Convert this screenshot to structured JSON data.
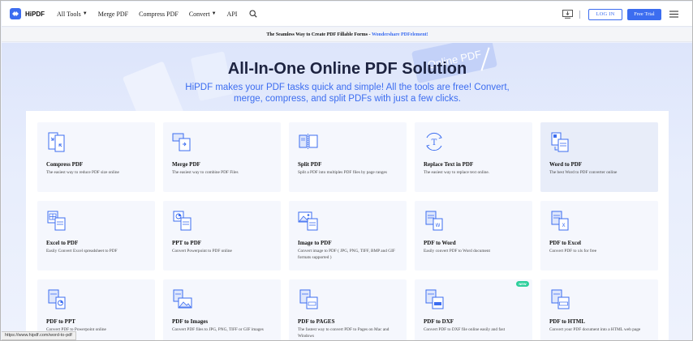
{
  "header": {
    "logo_text": "HiPDF",
    "nav": [
      {
        "label": "All Tools",
        "has_caret": true
      },
      {
        "label": "Merge PDF",
        "has_caret": false
      },
      {
        "label": "Compress PDF",
        "has_caret": false
      },
      {
        "label": "Convert",
        "has_caret": true
      },
      {
        "label": "API",
        "has_caret": false
      }
    ],
    "login_label": "LOG IN",
    "trial_label": "Free Trial"
  },
  "banner": {
    "text": "The Seamless Way to Create PDF Fillable Forms - ",
    "link": "Wondershare PDFelement!"
  },
  "hero": {
    "stamp_text": "Online PDF",
    "title": "All-In-One Online PDF Solution",
    "subtitle": "HiPDF makes your PDF tasks quick and simple! All the tools are free! Convert, merge, compress, and split PDFs with just a few clicks."
  },
  "tools": [
    {
      "title": "Compress PDF",
      "desc": "The easiest way to reduce PDF size online",
      "icon": "compress-icon"
    },
    {
      "title": "Merge PDF",
      "desc": "The easiest way to combine PDF Files",
      "icon": "merge-icon"
    },
    {
      "title": "Split PDF",
      "desc": "Split a PDF into multiples PDF files by page ranges",
      "icon": "split-icon"
    },
    {
      "title": "Replace Text in PDF",
      "desc": "The easiest way to replace text online.",
      "icon": "replace-text-icon"
    },
    {
      "title": "Word to PDF",
      "desc": "The best Word to PDF converter online",
      "icon": "word-to-pdf-icon"
    },
    {
      "title": "Excel to PDF",
      "desc": "Easily Convert Excel spreadsheet to PDF",
      "icon": "excel-to-pdf-icon"
    },
    {
      "title": "PPT to PDF",
      "desc": "Convert Powerpoint to PDF online",
      "icon": "ppt-to-pdf-icon"
    },
    {
      "title": "Image to PDF",
      "desc": "Convert image to PDF ( JPG, PNG, TIFF, BMP and GIF formats supported )",
      "icon": "image-to-pdf-icon"
    },
    {
      "title": "PDF to Word",
      "desc": "Easily convert PDF to Word document",
      "icon": "pdf-to-word-icon"
    },
    {
      "title": "PDF to Excel",
      "desc": "Convert PDF to xls for free",
      "icon": "pdf-to-excel-icon"
    },
    {
      "title": "PDF to PPT",
      "desc": "Convert PDF to Powerpoint online",
      "icon": "pdf-to-ppt-icon"
    },
    {
      "title": "PDF to Images",
      "desc": "Convert PDF files to JPG, PNG, TIFF or GIF images",
      "icon": "pdf-to-images-icon"
    },
    {
      "title": "PDF to PAGES",
      "desc": "The fastest way to convert PDF to Pages on Mac and Windows",
      "icon": "pdf-to-pages-icon"
    },
    {
      "title": "PDF to DXF",
      "desc": "Convert PDF to DXF file online easily and fast",
      "icon": "pdf-to-dxf-icon",
      "badge": "NEW"
    },
    {
      "title": "PDF to HTML",
      "desc": "Convert your PDF document into a HTML web page",
      "icon": "pdf-to-html-icon"
    }
  ],
  "status_url": "https://www.hipdf.com/word-to-pdf",
  "colors": {
    "accent": "#3c6df0",
    "badge": "#2ecf9c"
  }
}
